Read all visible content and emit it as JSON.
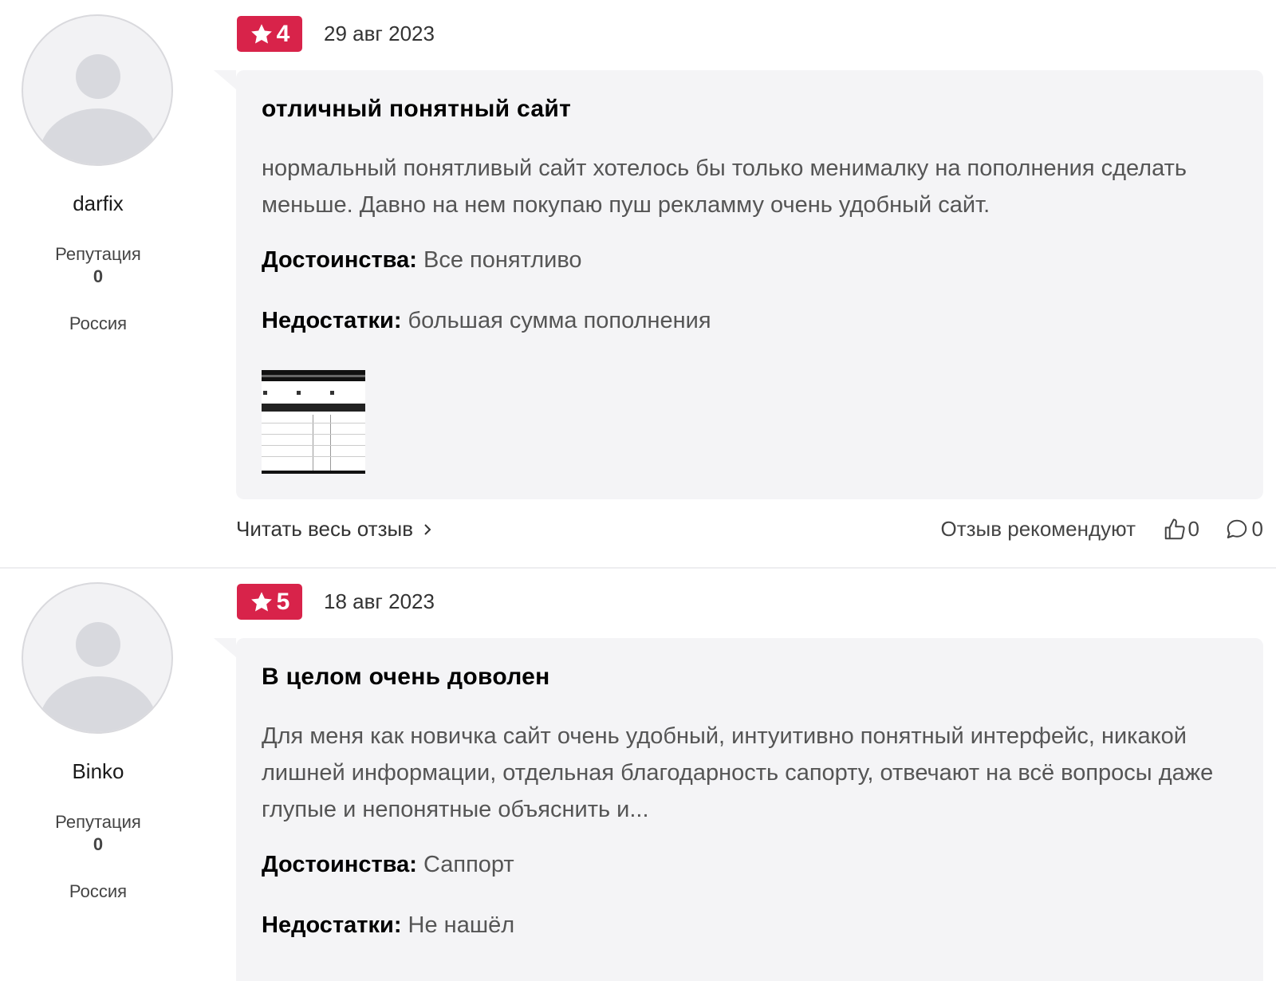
{
  "colors": {
    "badge": "#d8234a",
    "bubble": "#f4f4f6"
  },
  "reviews": [
    {
      "author": {
        "name": "darfix",
        "reputation_label": "Репутация",
        "reputation": "0",
        "country": "Россия"
      },
      "rating": "4",
      "date": "29 авг 2023",
      "title": "отличный понятный сайт",
      "text": "нормальный понятливый сайт хотелось бы только менималку на пополнения сделать меньше. Давно на нем покупаю пуш рекламму очень удобный сайт.",
      "pros_label": "Достоинства:",
      "pros": "Все понятливо",
      "cons_label": "Недостатки:",
      "cons": "большая сумма пополнения",
      "read_all": "Читать весь отзыв",
      "recommend_label": "Отзыв рекомендуют",
      "likes": "0",
      "comments": "0"
    },
    {
      "author": {
        "name": "Binko",
        "reputation_label": "Репутация",
        "reputation": "0",
        "country": "Россия"
      },
      "rating": "5",
      "date": "18 авг 2023",
      "title": "В целом очень доволен",
      "text": "Для меня как новичка сайт очень удобный, интуитивно понятный интерфейс, никакой лишней информации, отдельная благодарность сапорту, отвечают на всё вопросы даже глупые и непонятные объяснить и...",
      "pros_label": "Достоинства:",
      "pros": "Саппорт",
      "cons_label": "Недостатки:",
      "cons": "Не нашёл"
    }
  ]
}
